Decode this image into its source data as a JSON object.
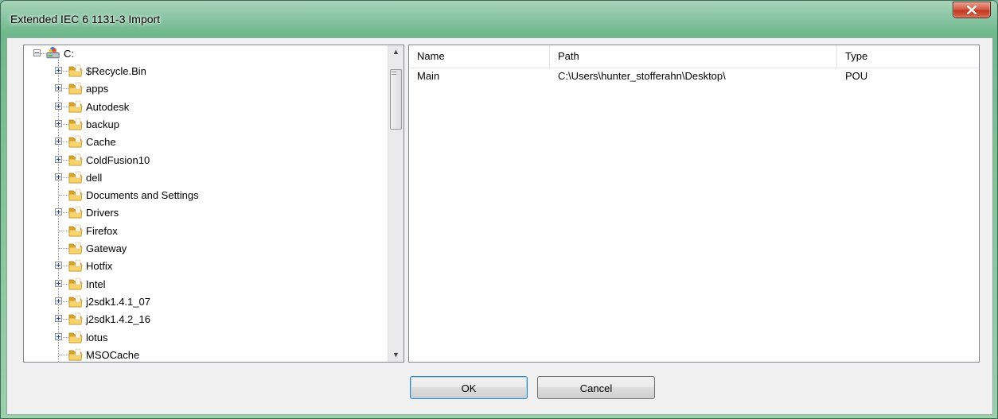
{
  "window": {
    "title": "Extended IEC 6 1131-3 Import"
  },
  "tree": {
    "root_label": "C:",
    "items": [
      {
        "label": "$Recycle.Bin",
        "expandable": true
      },
      {
        "label": "apps",
        "expandable": true
      },
      {
        "label": "Autodesk",
        "expandable": true
      },
      {
        "label": "backup",
        "expandable": true
      },
      {
        "label": "Cache",
        "expandable": true
      },
      {
        "label": "ColdFusion10",
        "expandable": true
      },
      {
        "label": "dell",
        "expandable": true
      },
      {
        "label": "Documents and Settings",
        "expandable": false
      },
      {
        "label": "Drivers",
        "expandable": true
      },
      {
        "label": "Firefox",
        "expandable": false
      },
      {
        "label": "Gateway",
        "expandable": false
      },
      {
        "label": "Hotfix",
        "expandable": true
      },
      {
        "label": "Intel",
        "expandable": true
      },
      {
        "label": "j2sdk1.4.1_07",
        "expandable": true
      },
      {
        "label": "j2sdk1.4.2_16",
        "expandable": true
      },
      {
        "label": "lotus",
        "expandable": true
      },
      {
        "label": "MSOCache",
        "expandable": false
      }
    ]
  },
  "list": {
    "columns": [
      "Name",
      "Path",
      "Type"
    ],
    "rows": [
      {
        "name": "Main",
        "path": "C:\\Users\\hunter_stofferahn\\Desktop\\",
        "type": "POU"
      }
    ]
  },
  "buttons": {
    "ok": "OK",
    "cancel": "Cancel"
  },
  "icons": {
    "close": "close-icon",
    "drive": "drive-icon",
    "folder": "folder-icon",
    "scroll_up": "scroll-up-arrow-icon",
    "scroll_down": "scroll-down-arrow-icon"
  }
}
